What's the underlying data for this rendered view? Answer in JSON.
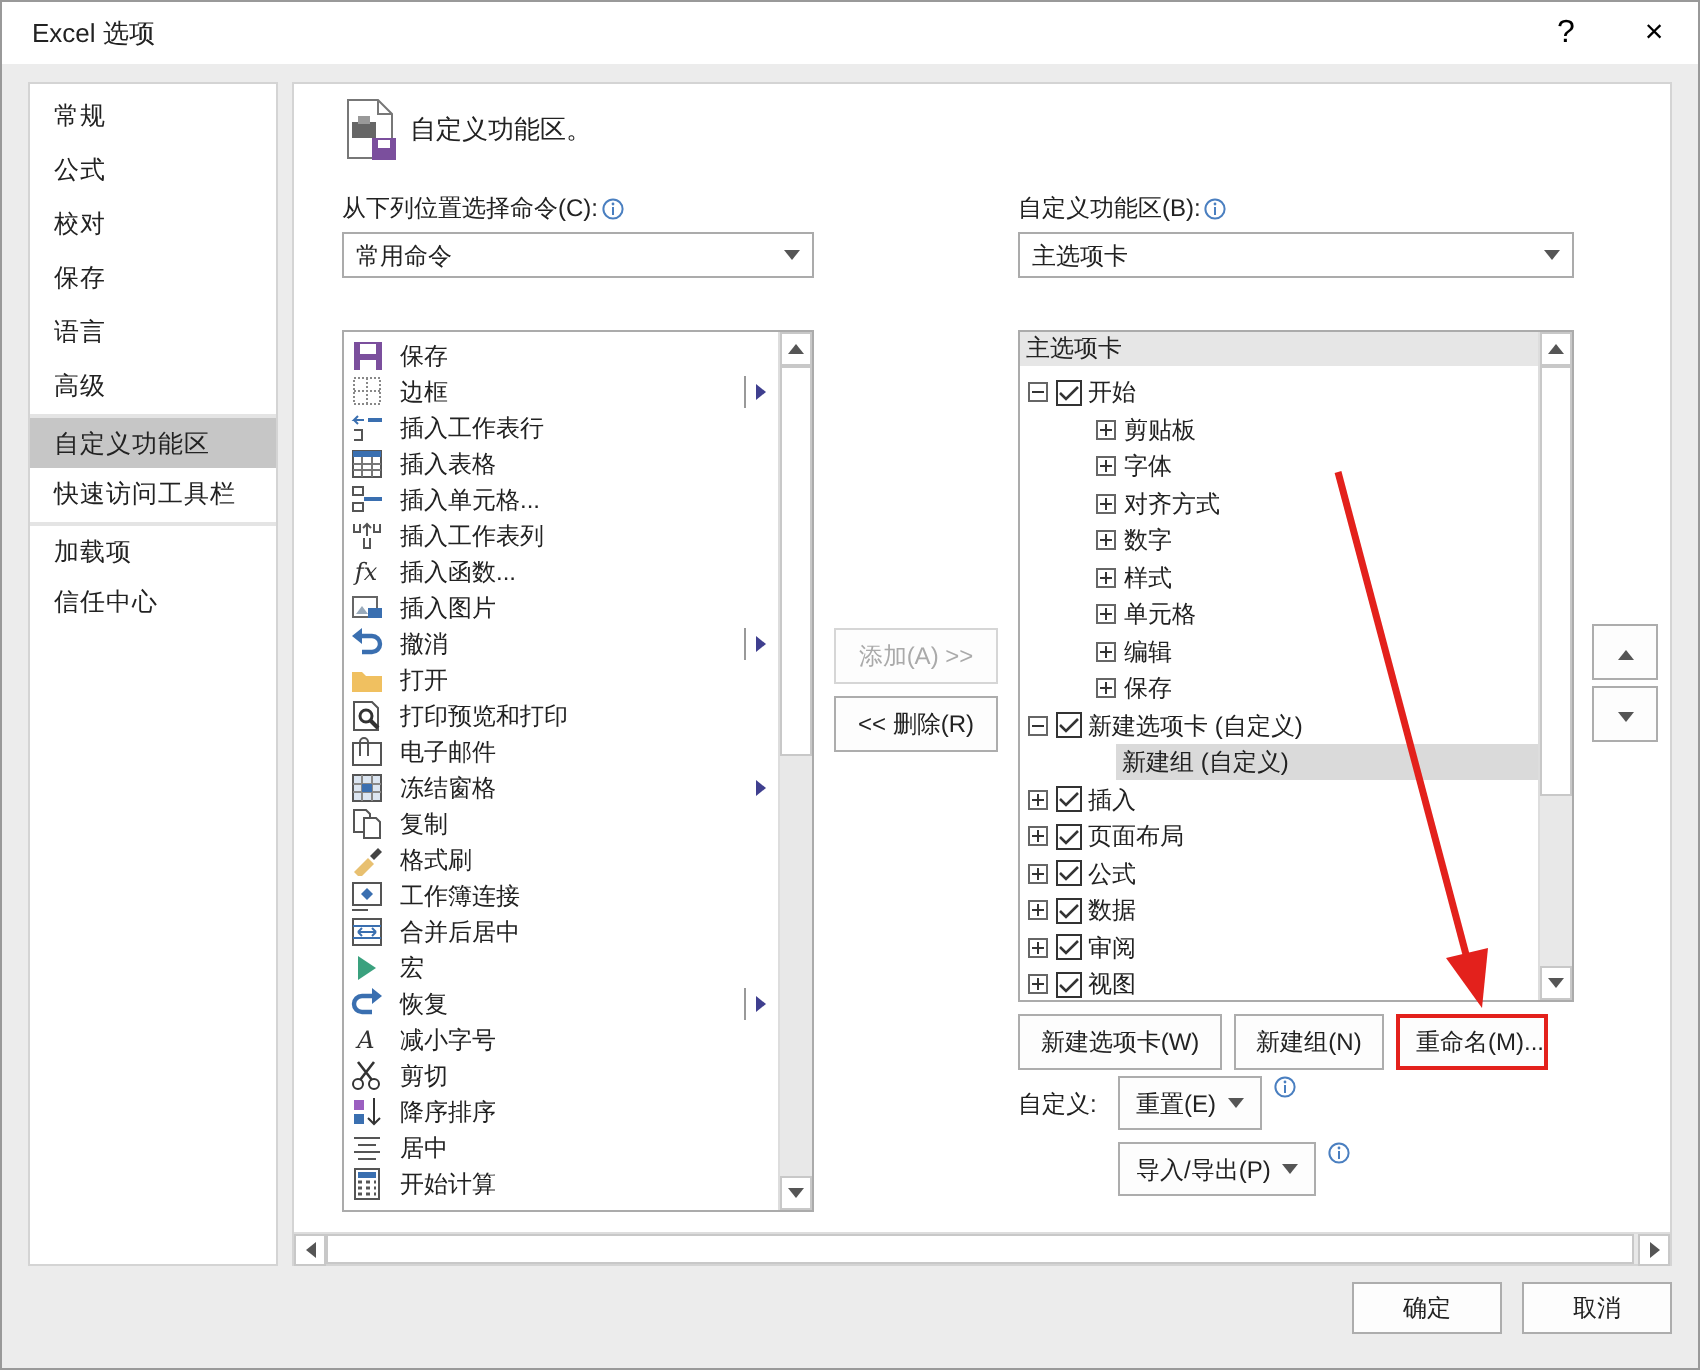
{
  "window": {
    "title": "Excel 选项",
    "help": "?",
    "close": "×"
  },
  "sidebar": {
    "items": [
      {
        "label": "常规",
        "selected": false,
        "divider_before": false
      },
      {
        "label": "公式",
        "selected": false,
        "divider_before": false
      },
      {
        "label": "校对",
        "selected": false,
        "divider_before": false
      },
      {
        "label": "保存",
        "selected": false,
        "divider_before": false
      },
      {
        "label": "语言",
        "selected": false,
        "divider_before": false
      },
      {
        "label": "高级",
        "selected": false,
        "divider_before": false
      },
      {
        "label": "自定义功能区",
        "selected": true,
        "divider_before": true
      },
      {
        "label": "快速访问工具栏",
        "selected": false,
        "divider_before": false
      },
      {
        "label": "加载项",
        "selected": false,
        "divider_before": true
      },
      {
        "label": "信任中心",
        "selected": false,
        "divider_before": false
      }
    ]
  },
  "header": {
    "title": "自定义功能区。"
  },
  "commands": {
    "label": "从下列位置选择命令(C):",
    "dropdown": "常用命令",
    "items": [
      {
        "label": "保存",
        "kind": "save",
        "submenu": false
      },
      {
        "label": "边框",
        "kind": "borders",
        "submenu": true,
        "split": true
      },
      {
        "label": "插入工作表行",
        "kind": "insertrow",
        "submenu": false
      },
      {
        "label": "插入表格",
        "kind": "table",
        "submenu": false
      },
      {
        "label": "插入单元格...",
        "kind": "insertcell",
        "submenu": false
      },
      {
        "label": "插入工作表列",
        "kind": "insertcolumn",
        "submenu": false
      },
      {
        "label": "插入函数...",
        "kind": "glyph",
        "glyph": "fx",
        "submenu": false
      },
      {
        "label": "插入图片",
        "kind": "picture",
        "submenu": false
      },
      {
        "label": "撤消",
        "kind": "undo",
        "submenu": true,
        "split": true
      },
      {
        "label": "打开",
        "kind": "folder",
        "submenu": false
      },
      {
        "label": "打印预览和打印",
        "kind": "preview",
        "submenu": false
      },
      {
        "label": "电子邮件",
        "kind": "mail",
        "submenu": false
      },
      {
        "label": "冻结窗格",
        "kind": "freeze",
        "submenu": true,
        "split": false
      },
      {
        "label": "复制",
        "kind": "copy",
        "submenu": false
      },
      {
        "label": "格式刷",
        "kind": "brush",
        "submenu": false
      },
      {
        "label": "工作簿连接",
        "kind": "link",
        "submenu": false
      },
      {
        "label": "合并后居中",
        "kind": "merge",
        "submenu": false
      },
      {
        "label": "宏",
        "kind": "play",
        "submenu": false
      },
      {
        "label": "恢复",
        "kind": "redo",
        "submenu": true,
        "split": true
      },
      {
        "label": "减小字号",
        "kind": "glyph",
        "glyph": "A",
        "submenu": false
      },
      {
        "label": "剪切",
        "kind": "scissors",
        "submenu": false
      },
      {
        "label": "降序排序",
        "kind": "sort",
        "submenu": false
      },
      {
        "label": "居中",
        "kind": "center",
        "submenu": false
      },
      {
        "label": "开始计算",
        "kind": "calculator",
        "submenu": false
      }
    ]
  },
  "transfer": [
    {
      "label": "添加(A) >>",
      "disabled": true
    },
    {
      "label": "<< 删除(R)",
      "disabled": false
    }
  ],
  "ribbon": {
    "label": "自定义功能区(B):",
    "dropdown": "主选项卡",
    "tree_header": "主选项卡",
    "tree": [
      {
        "label": "开始",
        "checked": true,
        "expanded": true,
        "selected": false,
        "children": [
          {
            "label": "剪贴板",
            "expanded": false,
            "selected": false
          },
          {
            "label": "字体",
            "expanded": false,
            "selected": false
          },
          {
            "label": "对齐方式",
            "expanded": false,
            "selected": false
          },
          {
            "label": "数字",
            "expanded": false,
            "selected": false
          },
          {
            "label": "样式",
            "expanded": false,
            "selected": false
          },
          {
            "label": "单元格",
            "expanded": false,
            "selected": false
          },
          {
            "label": "编辑",
            "expanded": false,
            "selected": false
          },
          {
            "label": "保存",
            "expanded": false,
            "selected": false
          }
        ]
      },
      {
        "label": "新建选项卡 (自定义)",
        "checked": true,
        "expanded": true,
        "selected": false,
        "children": [
          {
            "label": "新建组 (自定义)",
            "selected": true
          }
        ]
      },
      {
        "label": "插入",
        "checked": true,
        "expanded": false,
        "selected": false
      },
      {
        "label": "页面布局",
        "checked": true,
        "expanded": false,
        "selected": false
      },
      {
        "label": "公式",
        "checked": true,
        "expanded": false,
        "selected": false
      },
      {
        "label": "数据",
        "checked": true,
        "expanded": false,
        "selected": false
      },
      {
        "label": "审阅",
        "checked": true,
        "expanded": false,
        "selected": false
      },
      {
        "label": "视图",
        "checked": true,
        "expanded": false,
        "selected": false
      }
    ]
  },
  "ribbon_buttons": [
    {
      "label": "新建选项卡(W)",
      "highlighted": false
    },
    {
      "label": "新建组(N)",
      "highlighted": false
    },
    {
      "label": "重命名(M)...",
      "highlighted": true
    }
  ],
  "customize": {
    "label": "自定义:",
    "reset": "重置(E)",
    "import_export": "导入/导出(P)"
  },
  "footer": {
    "buttons": [
      "确定",
      "取消"
    ]
  },
  "annotation": {
    "kind": "arrow"
  }
}
